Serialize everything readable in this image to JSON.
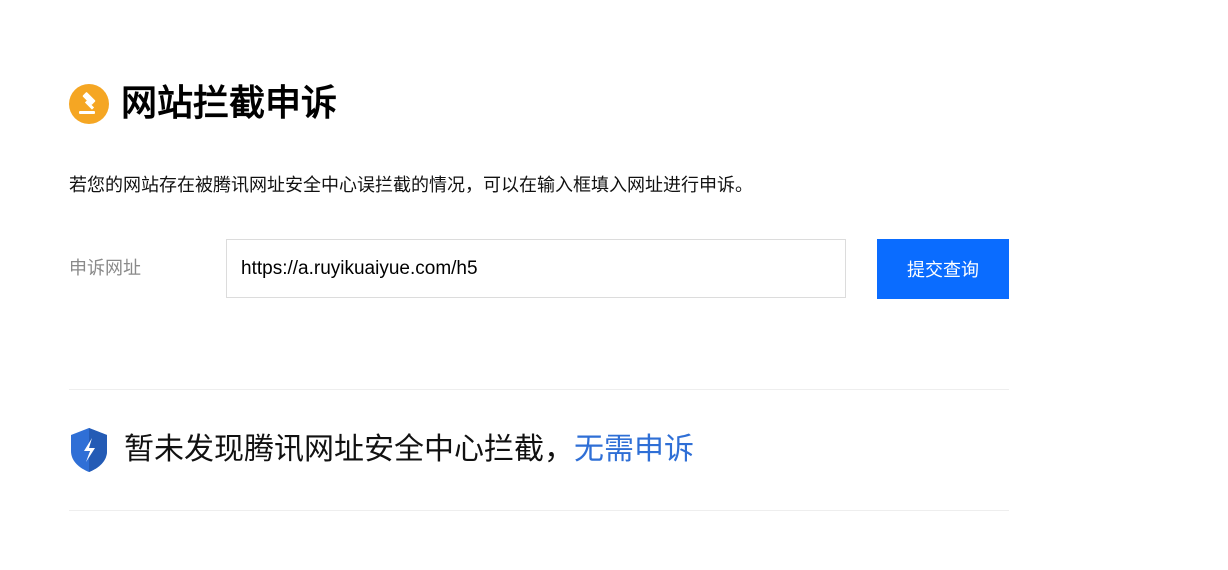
{
  "header": {
    "title": "网站拦截申诉",
    "icon": "gavel-icon",
    "icon_color": "#f5a623"
  },
  "intro": {
    "text": "若您的网站存在被腾讯网址安全中心误拦截的情况，可以在输入框填入网址进行申诉。"
  },
  "form": {
    "label": "申诉网址",
    "url_value": "https://a.ruyikuaiyue.com/h5",
    "submit_label": "提交查询",
    "submit_color": "#0a6cff"
  },
  "result": {
    "icon": "shield-icon",
    "icon_color": "#2f6fd6",
    "message": "暂未发现腾讯网址安全中心拦截，",
    "highlight": "无需申诉",
    "highlight_color": "#2f6fd6"
  }
}
